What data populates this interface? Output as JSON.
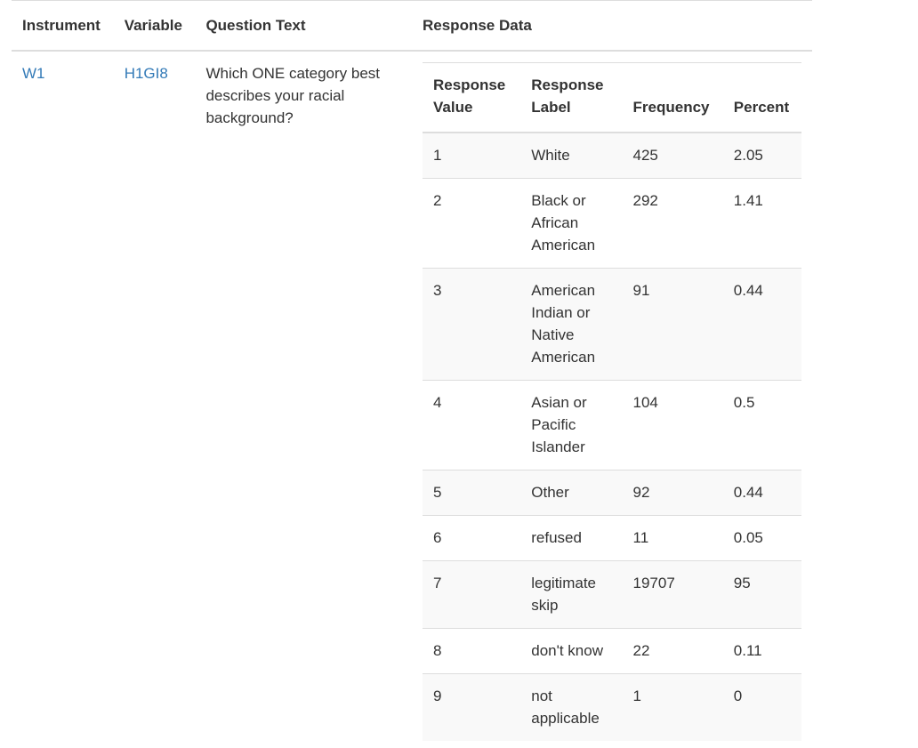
{
  "headers": {
    "instrument": "Instrument",
    "variable": "Variable",
    "question_text": "Question Text",
    "response_data": "Response Data"
  },
  "row": {
    "instrument": "W1",
    "variable": "H1GI8",
    "question": "Which ONE category best describes your racial background?"
  },
  "response_table": {
    "headers": {
      "value": "Response Value",
      "label": "Response Label",
      "frequency": "Frequency",
      "percent": "Percent"
    },
    "rows": [
      {
        "value": "1",
        "label": "White",
        "frequency": "425",
        "percent": "2.05"
      },
      {
        "value": "2",
        "label": "Black or African American",
        "frequency": "292",
        "percent": "1.41"
      },
      {
        "value": "3",
        "label": "American Indian or Native American",
        "frequency": "91",
        "percent": "0.44"
      },
      {
        "value": "4",
        "label": "Asian or Pacific Islander",
        "frequency": "104",
        "percent": "0.5"
      },
      {
        "value": "5",
        "label": "Other",
        "frequency": "92",
        "percent": "0.44"
      },
      {
        "value": "6",
        "label": "refused",
        "frequency": "11",
        "percent": "0.05"
      },
      {
        "value": "7",
        "label": "legitimate skip",
        "frequency": "19707",
        "percent": "95"
      },
      {
        "value": "8",
        "label": "don't know",
        "frequency": "22",
        "percent": "0.11"
      },
      {
        "value": "9",
        "label": "not applicable",
        "frequency": "1",
        "percent": "0"
      }
    ]
  }
}
